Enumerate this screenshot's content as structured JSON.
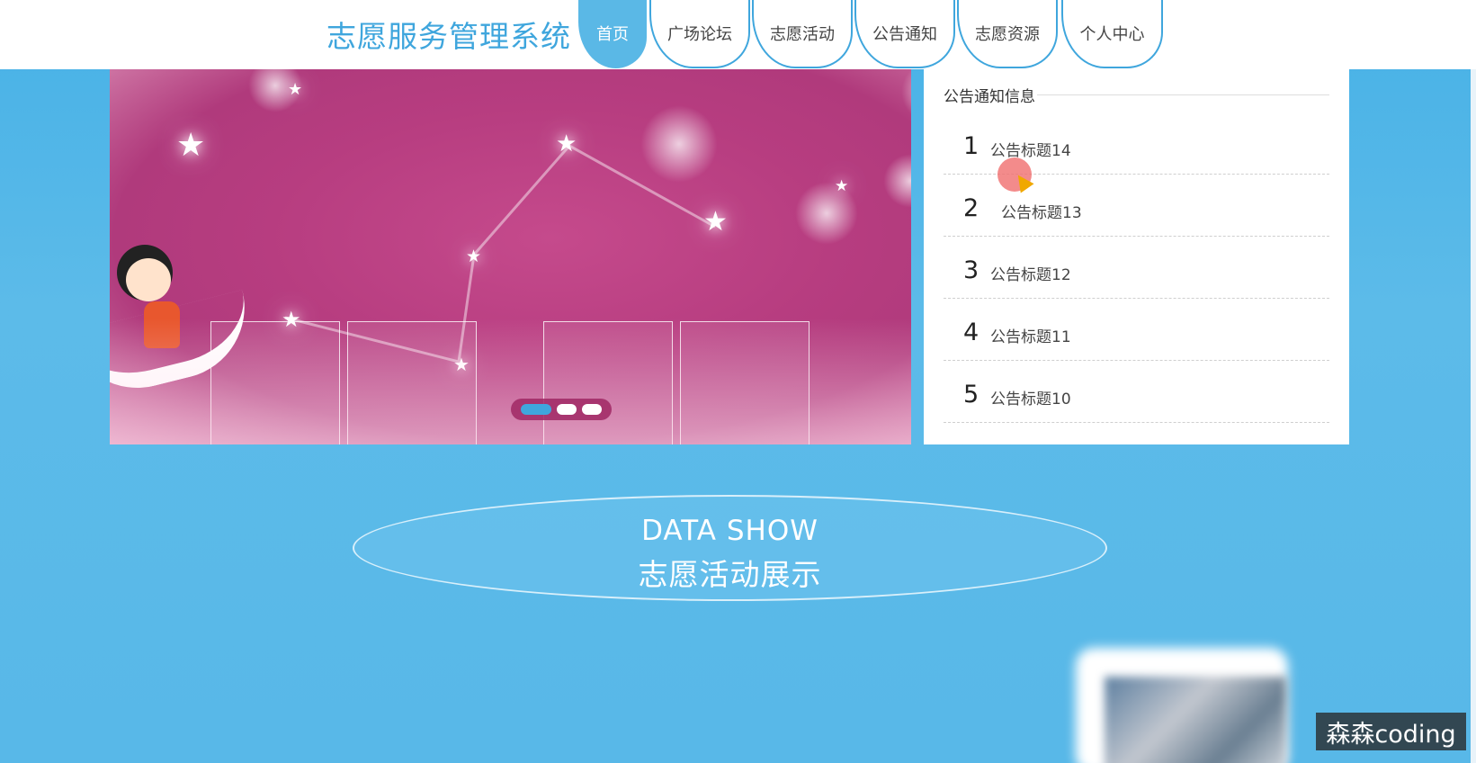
{
  "header": {
    "site_title": "志愿服务管理系统",
    "nav": [
      "首页",
      "广场论坛",
      "志愿活动",
      "公告通知",
      "志愿资源",
      "个人中心"
    ],
    "active_nav": "首页"
  },
  "banner": {
    "slide_count": 3,
    "active_slide": 1
  },
  "notice": {
    "title": "公告通知信息",
    "items": [
      {
        "num": "1",
        "title": "公告标题14"
      },
      {
        "num": "2",
        "title": "公告标题13"
      },
      {
        "num": "3",
        "title": "公告标题12"
      },
      {
        "num": "4",
        "title": "公告标题11"
      },
      {
        "num": "5",
        "title": "公告标题10"
      }
    ]
  },
  "section": {
    "en_title": "DATA SHOW",
    "cn_title": "志愿活动展示"
  },
  "watermark": "森森coding",
  "colors": {
    "accent": "#3fa6dd",
    "background": "#58b8e8",
    "banner": "#b73d80"
  }
}
